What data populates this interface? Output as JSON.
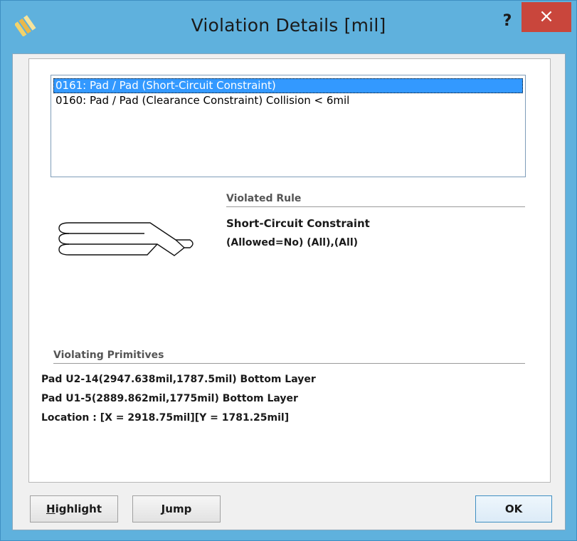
{
  "window": {
    "title": "Violation Details [mil]",
    "help_label": "?",
    "close_label": "×"
  },
  "violations": [
    {
      "label": "0161: Pad / Pad (Short-Circuit Constraint)",
      "selected": true
    },
    {
      "label": "0160: Pad / Pad (Clearance Constraint) Collision < 6mil",
      "selected": false
    }
  ],
  "rule": {
    "header": "Violated Rule",
    "name": "Short-Circuit Constraint",
    "detail": "(Allowed=No) (All),(All)",
    "graphic_icon": "short-circuit-diagram-icon"
  },
  "primitives": {
    "header": "Violating Primitives",
    "lines": [
      "Pad U2-14(2947.638mil,1787.5mil)  Bottom Layer",
      "Pad U1-5(2889.862mil,1775mil)  Bottom Layer"
    ],
    "location": "Location : [X = 2918.75mil][Y = 1781.25mil]"
  },
  "buttons": {
    "highlight_mnemonic": "H",
    "highlight_rest": "ighlight",
    "jump_mnemonic": "J",
    "jump_rest": "ump",
    "ok": "OK"
  },
  "colors": {
    "titlebar": "#5fb1dd",
    "close": "#c9463c",
    "selection": "#3399ff"
  }
}
